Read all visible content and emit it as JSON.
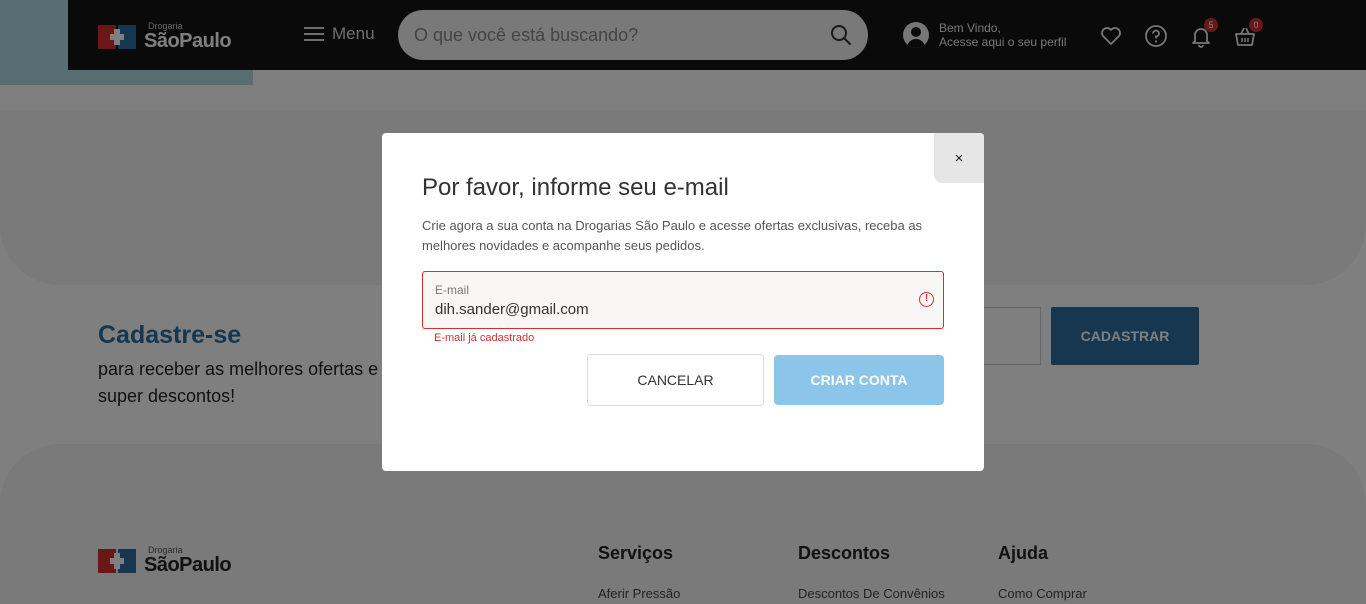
{
  "header": {
    "logo_small": "Drogaria",
    "logo_big": "SãoPaulo",
    "menu_label": "Menu",
    "search_placeholder": "O que você está buscando?",
    "profile_line1": "Bem Vindo,",
    "profile_line2": "Acesse aqui o seu perfil",
    "notifications_count": "5",
    "cart_count": "0"
  },
  "signup": {
    "title": "Cadastre-se",
    "subtitle": "para receber as melhores ofertas e super descontos!",
    "button_label": "CADASTRAR"
  },
  "footer": {
    "logo_small": "Drogaria",
    "logo_big": "SãoPaulo",
    "columns": [
      {
        "title": "Serviços",
        "first_link": "Aferir Pressão"
      },
      {
        "title": "Descontos",
        "first_link": "Descontos De Convênios"
      },
      {
        "title": "Ajuda",
        "first_link": "Como Comprar"
      }
    ]
  },
  "modal": {
    "close_label": "×",
    "title": "Por favor, informe seu e-mail",
    "description": "Crie agora a sua conta na Drogarias São Paulo e acesse ofertas exclusivas, receba as melhores novidades e acompanhe seus pedidos.",
    "email_label": "E-mail",
    "email_value": "dih.sander@gmail.com",
    "error_icon": "!",
    "error_message": "E-mail já cadastrado",
    "cancel_label": "CANCELAR",
    "create_label": "CRIAR CONTA"
  },
  "colors": {
    "brand_red": "#d3312f",
    "brand_blue": "#2d6e9e",
    "create_button": "#8cc5ea"
  }
}
